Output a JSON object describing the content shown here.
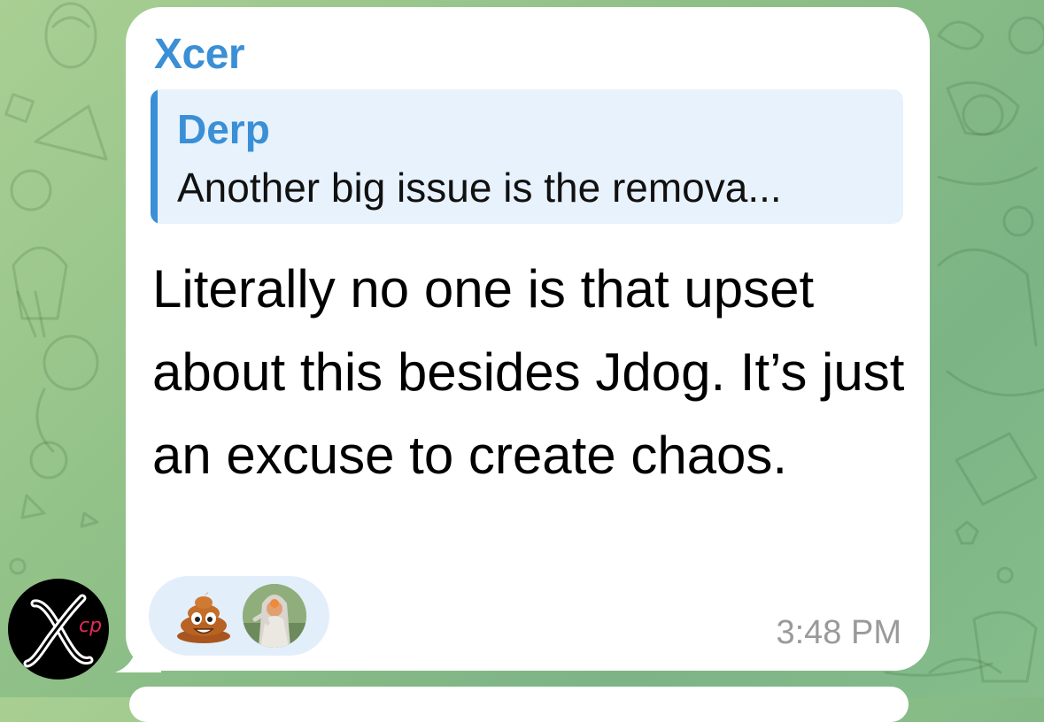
{
  "message": {
    "sender": "Xcer",
    "reply": {
      "author": "Derp",
      "text": "Another big issue is the remova..."
    },
    "text": "Literally no one is that upset about this besides Jdog. It’s just an excuse to create chaos.",
    "reactions": [
      {
        "type": "emoji",
        "icon": "pile-of-poo-icon"
      },
      {
        "type": "user-avatar",
        "icon": "reactor-avatar"
      }
    ],
    "time": "3:48 PM"
  },
  "sender_avatar": {
    "logo_text": "cp",
    "accent": "#e8285a"
  },
  "colors": {
    "accent": "#3a8fd6",
    "reply_background": "#e8f2fc",
    "reaction_background": "#e3eefb",
    "timestamp": "#9a9a9a",
    "wallpaper": "#8fc087"
  }
}
